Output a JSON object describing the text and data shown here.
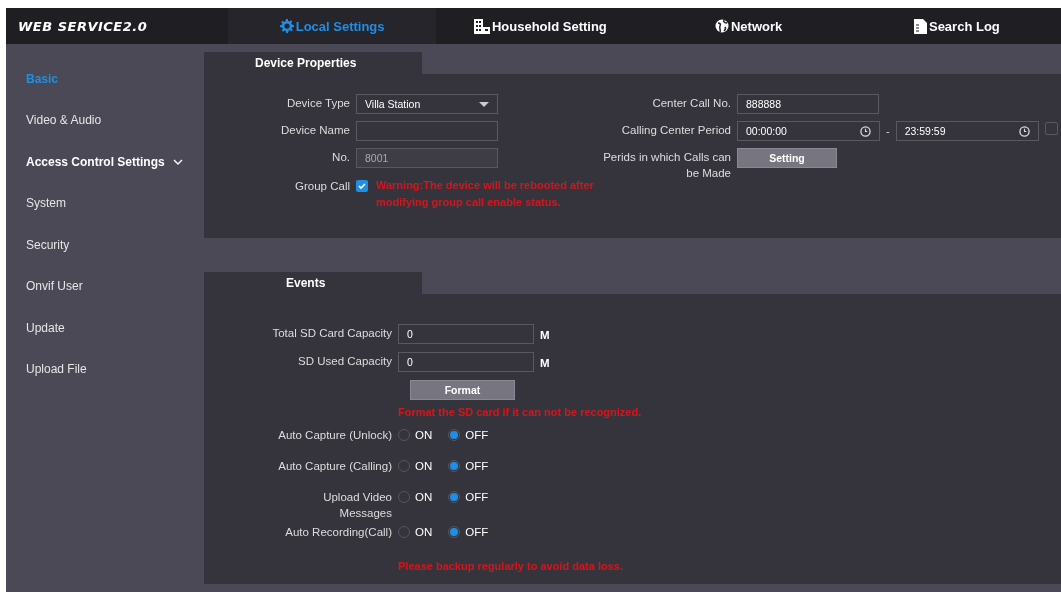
{
  "header": {
    "logo": "WEB SERVICE2.0",
    "tabs": [
      {
        "label": "Local Settings",
        "selected": true
      },
      {
        "label": "Household Setting",
        "selected": false
      },
      {
        "label": "Network",
        "selected": false
      },
      {
        "label": "Search Log",
        "selected": false
      }
    ]
  },
  "sidebar": {
    "items": [
      {
        "label": "Basic",
        "kind": "link",
        "selected": true
      },
      {
        "label": "Video & Audio",
        "kind": "link",
        "selected": false
      },
      {
        "label": "Access Control Settings",
        "kind": "group",
        "selected": false
      },
      {
        "label": "System",
        "kind": "link",
        "selected": false
      },
      {
        "label": "Security",
        "kind": "link",
        "selected": false
      },
      {
        "label": "Onvif User",
        "kind": "link",
        "selected": false
      },
      {
        "label": "Update",
        "kind": "link",
        "selected": false
      },
      {
        "label": "Upload File",
        "kind": "link",
        "selected": false
      }
    ]
  },
  "device_properties": {
    "title": "Device Properties",
    "device_type": {
      "label": "Device Type",
      "value": "Villa Station"
    },
    "device_name": {
      "label": "Device Name"
    },
    "number": {
      "label": "No.",
      "value": "8001",
      "disabled": true
    },
    "group_call": {
      "label": "Group Call",
      "checked": true,
      "warning": "Warning:The device will be rebooted after modifying group call enable status."
    },
    "center_call_no": {
      "label": "Center Call No.",
      "value": "888888"
    },
    "calling_center_period": {
      "label": "Calling Center Period",
      "start": "00:00:00",
      "separator": "-",
      "end": "23:59:59",
      "checked": false
    },
    "call_periods": {
      "label": "Perids in which Calls can be Made",
      "button": "Setting"
    }
  },
  "events": {
    "title": "Events",
    "capacities": [
      {
        "label": "Total SD Card Capacity",
        "value": "0",
        "unit": "M"
      },
      {
        "label": "SD Used Capacity",
        "value": "0",
        "unit": "M"
      }
    ],
    "format_button": "Format",
    "format_note": "Format the SD card if it can not be recognized.",
    "toggles": [
      {
        "label": "Auto Capture (Unlock)",
        "options": [
          {
            "label": "ON",
            "selected": false
          },
          {
            "label": "OFF",
            "selected": true
          }
        ]
      },
      {
        "label": "Auto Capture (Calling)",
        "options": [
          {
            "label": "ON",
            "selected": false
          },
          {
            "label": "OFF",
            "selected": true
          }
        ]
      },
      {
        "label": "Upload Video Messages",
        "options": [
          {
            "label": "ON",
            "selected": false
          },
          {
            "label": "OFF",
            "selected": true
          }
        ]
      },
      {
        "label": "Auto Recording(Call)",
        "options": [
          {
            "label": "ON",
            "selected": false
          },
          {
            "label": "OFF",
            "selected": true
          }
        ]
      }
    ],
    "backup_note": "Please backup regularly to avoid data loss."
  }
}
